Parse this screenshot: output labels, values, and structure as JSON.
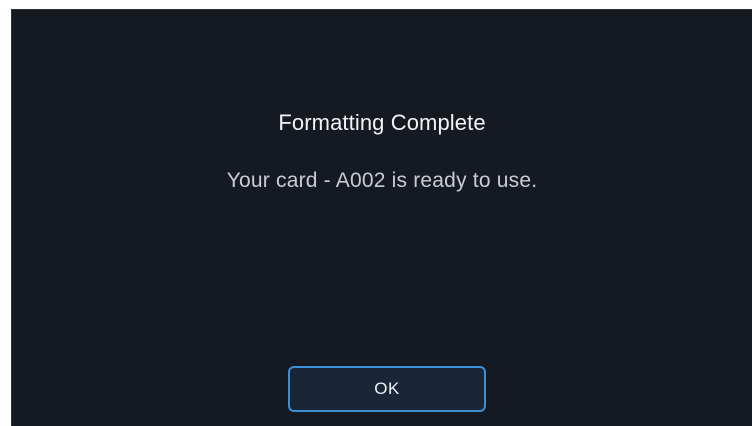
{
  "dialog": {
    "title": "Formatting Complete",
    "message": "Your card - A002 is ready to use.",
    "ok_label": "OK"
  },
  "colors": {
    "background": "#141922",
    "accent": "#3b8fd6",
    "button_fill": "#182638",
    "title_text": "#f2f3f5",
    "message_text": "#c9ccd2"
  }
}
